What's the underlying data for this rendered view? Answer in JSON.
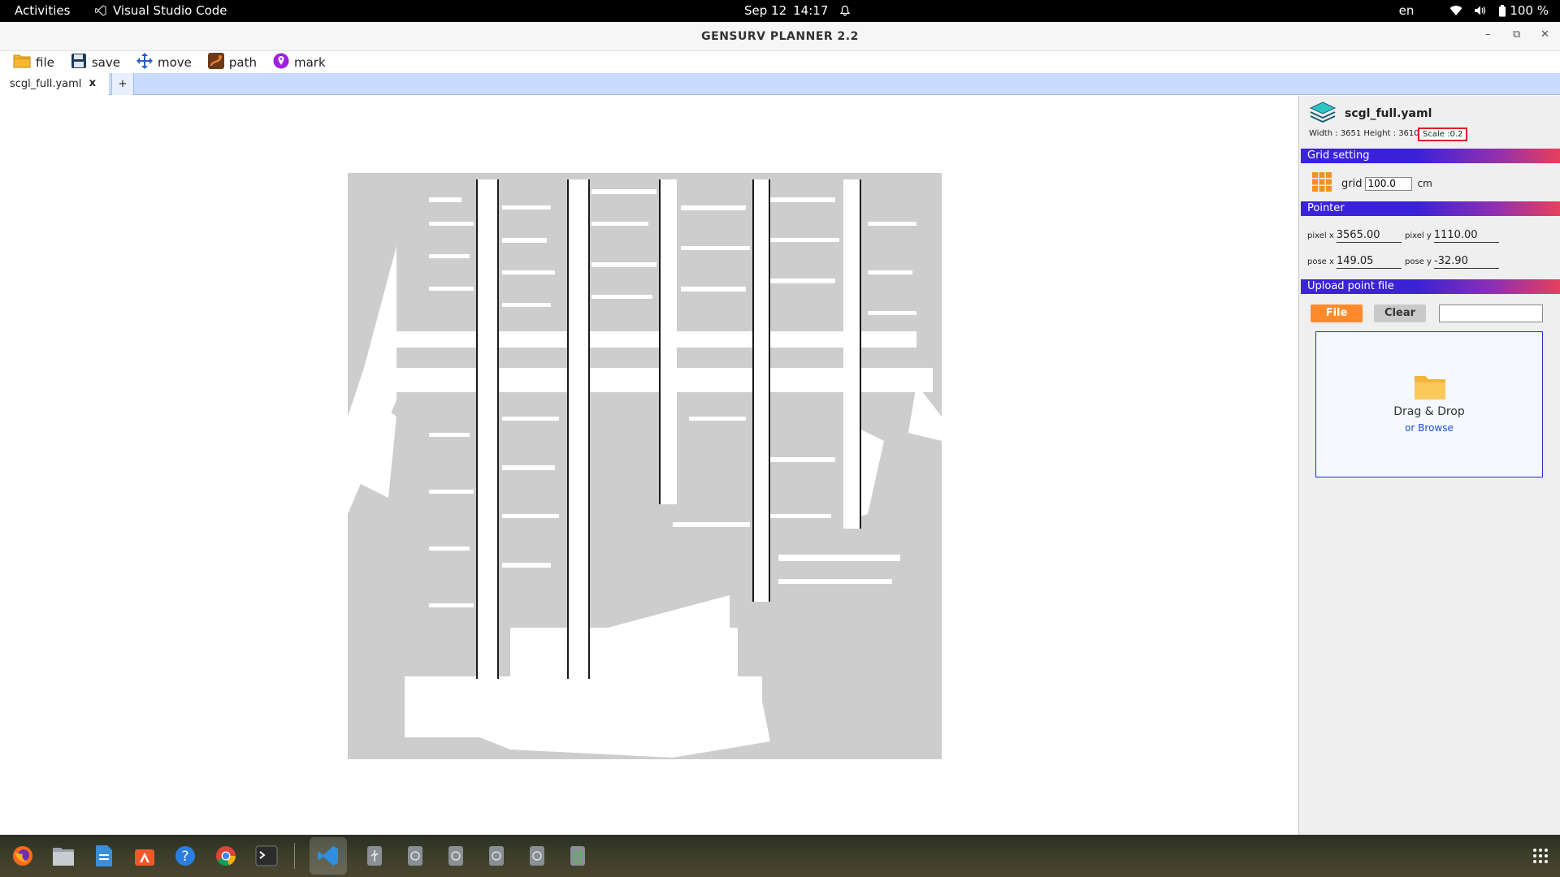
{
  "topbar": {
    "activities": "Activities",
    "app_name": "Visual Studio Code",
    "date": "Sep 12",
    "time": "14:17",
    "lang": "en",
    "battery": "100 %"
  },
  "window": {
    "title": "GENSURV PLANNER 2.2"
  },
  "toolbar": {
    "file_label": "file",
    "save_label": "save",
    "move_label": "move",
    "path_label": "path",
    "mark_label": "mark"
  },
  "tabs": {
    "active_tab": "scgl_full.yaml",
    "close": "x",
    "add": "+"
  },
  "panel": {
    "map_name": "scgl_full.yaml",
    "dimensions": "Width : 3651 Height : 3610",
    "scale": "Scale :0.2",
    "grid_section": "Grid setting",
    "grid_label": "grid",
    "grid_value": "100.0",
    "grid_unit": "cm",
    "pointer_section": "Pointer",
    "pixel_x_label": "pixel x",
    "pixel_x": "3565.00",
    "pixel_y_label": "pixel y",
    "pixel_y": "1110.00",
    "pose_x_label": "pose x",
    "pose_x": "149.05",
    "pose_y_label": "pose y",
    "pose_y": "-32.90",
    "upload_section": "Upload point file",
    "file_button": "File",
    "clear_button": "Clear",
    "drop_text": "Drag & Drop",
    "browse_text": "or Browse"
  },
  "colors": {
    "accent_orange": "#ff8a2b",
    "section_gradient_start": "#3a22e0",
    "section_gradient_end": "#e8405a",
    "tabstrip": "#c9dcff",
    "map_background": "#cdcdcd"
  },
  "dock_icons": [
    "firefox-icon",
    "files-icon",
    "text-editor-icon",
    "app-center-icon",
    "help-icon",
    "chrome-icon",
    "terminal-icon",
    "vscode-icon",
    "usb-icon",
    "disk-icon",
    "disk-icon",
    "disk-icon",
    "disk-icon",
    "trash-icon",
    "show-apps-icon"
  ]
}
